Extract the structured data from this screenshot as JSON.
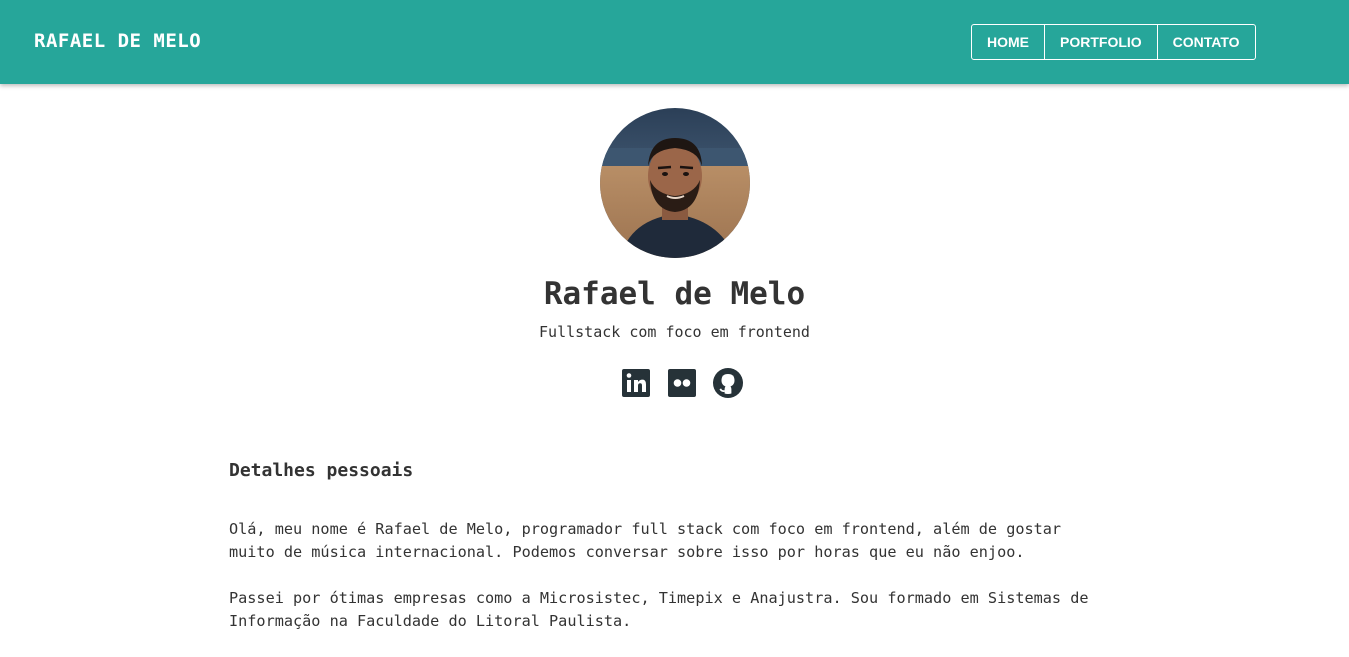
{
  "header": {
    "brand": "RAFAEL DE MELO",
    "nav": [
      "HOME",
      "PORTFOLIO",
      "CONTATO"
    ]
  },
  "profile": {
    "name": "Rafael de Melo",
    "subtitle": "Fullstack com foco em frontend",
    "socials": [
      "linkedin-icon",
      "flickr-icon",
      "github-icon"
    ]
  },
  "about": {
    "title": "Detalhes pessoais",
    "paragraphs": [
      "Olá, meu nome é Rafael de Melo, programador full stack com foco em frontend, além de gostar muito de música internacional. Podemos conversar sobre isso por horas que eu não enjoo.",
      "Passei por ótimas empresas como a Microsistec, Timepix e Anajustra. Sou formado em Sistemas de Informação na Faculdade do Litoral Paulista."
    ]
  },
  "colors": {
    "navbar": "#26a69a",
    "text": "#333333",
    "icon": "#263238"
  }
}
